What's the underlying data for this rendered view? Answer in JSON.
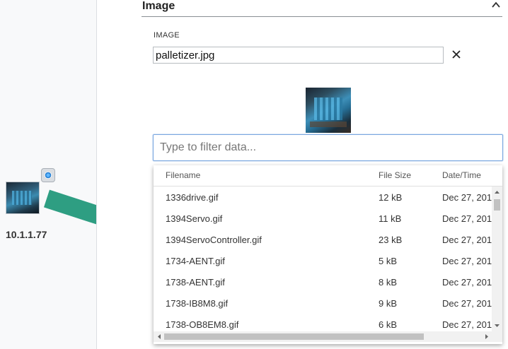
{
  "canvas": {
    "device_ip": "10.1.1.77",
    "link_color": "#2e9e82"
  },
  "section": {
    "title": "Image",
    "collapse_icon": "chevron-up-icon"
  },
  "image_field": {
    "label": "IMAGE",
    "value": "palletizer.jpg",
    "clear_icon": "close-icon"
  },
  "filter": {
    "placeholder": "Type to filter data..."
  },
  "table": {
    "headers": {
      "filename": "Filename",
      "size": "File Size",
      "date": "Date/Time"
    },
    "rows": [
      {
        "name": "1336drive.gif",
        "size": "12 kB",
        "date": "Dec 27, 201"
      },
      {
        "name": "1394Servo.gif",
        "size": "11 kB",
        "date": "Dec 27, 201"
      },
      {
        "name": "1394ServoController.gif",
        "size": "23 kB",
        "date": "Dec 27, 201"
      },
      {
        "name": "1734-AENT.gif",
        "size": "5 kB",
        "date": "Dec 27, 201"
      },
      {
        "name": "1738-AENT.gif",
        "size": "8 kB",
        "date": "Dec 27, 201"
      },
      {
        "name": "1738-IB8M8.gif",
        "size": "9 kB",
        "date": "Dec 27, 201"
      },
      {
        "name": "1738-OB8EM8.gif",
        "size": "6 kB",
        "date": "Dec 27, 201"
      }
    ]
  },
  "colors": {
    "accent_border": "#7aa7e0",
    "link": "#2e9e82"
  }
}
